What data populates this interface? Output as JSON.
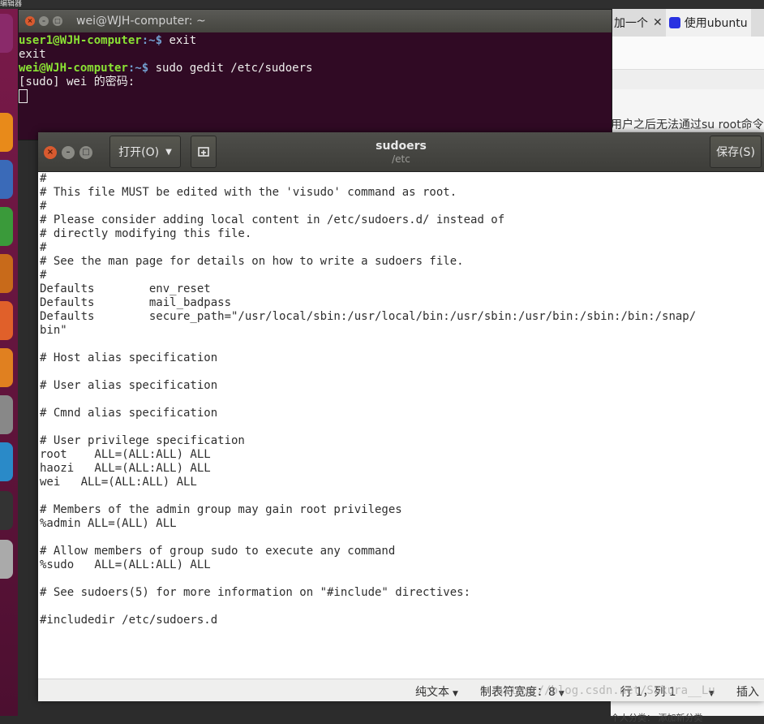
{
  "topbar": {
    "title": "编辑器"
  },
  "terminal": {
    "title": "wei@WJH-computer: ~",
    "lines": [
      {
        "user": "user1@WJH-computer",
        "path": ":~$",
        "cmd": " exit"
      },
      {
        "text": "exit"
      },
      {
        "user": "wei@WJH-computer",
        "path": ":~$",
        "cmd": " sudo gedit /etc/sudoers"
      },
      {
        "text": "[sudo] wei 的密码:"
      }
    ]
  },
  "browser": {
    "tabs": [
      {
        "label": "加一个"
      },
      {
        "label": "使用ubuntu"
      }
    ],
    "heading": "用户之后无法通过su root命令",
    "bottom_text": "个人分类： 添加新分类"
  },
  "gedit": {
    "open_label": "打开(O)",
    "save_label": "保存(S)",
    "title": "sudoers",
    "subtitle": "/etc",
    "lines": [
      "#",
      "# This file MUST be edited with the 'visudo' command as root.",
      "#",
      "# Please consider adding local content in /etc/sudoers.d/ instead of",
      "# directly modifying this file.",
      "#",
      "# See the man page for details on how to write a sudoers file.",
      "#",
      "Defaults        env_reset",
      "Defaults        mail_badpass",
      "Defaults        secure_path=\"/usr/local/sbin:/usr/local/bin:/usr/sbin:/usr/bin:/sbin:/bin:/snap/",
      "bin\"",
      "",
      "# Host alias specification",
      "",
      "# User alias specification",
      "",
      "# Cmnd alias specification",
      "",
      "# User privilege specification",
      "root    ALL=(ALL:ALL) ALL",
      "haozi   ALL=(ALL:ALL) ALL",
      "wei   ALL=(ALL:ALL) ALL",
      "",
      "# Members of the admin group may gain root privileges",
      "%admin ALL=(ALL) ALL",
      "",
      "# Allow members of group sudo to execute any command",
      "%sudo   ALL=(ALL:ALL) ALL",
      "",
      "# See sudoers(5) for more information on \"#include\" directives:",
      "",
      "#includedir /etc/sudoers.d"
    ],
    "status": {
      "language": "纯文本",
      "tab_width": "制表符宽度：8",
      "position": "行 1，列 1",
      "mode": "插入"
    }
  },
  "watermark": "https://blog.csdn.net/Sakura__Lu",
  "colors": {
    "terminal_bg": "#300a24",
    "prompt_user": "#8ae234",
    "prompt_path": "#729fcf",
    "launcher": "#5e1238",
    "header": "#45453f"
  }
}
